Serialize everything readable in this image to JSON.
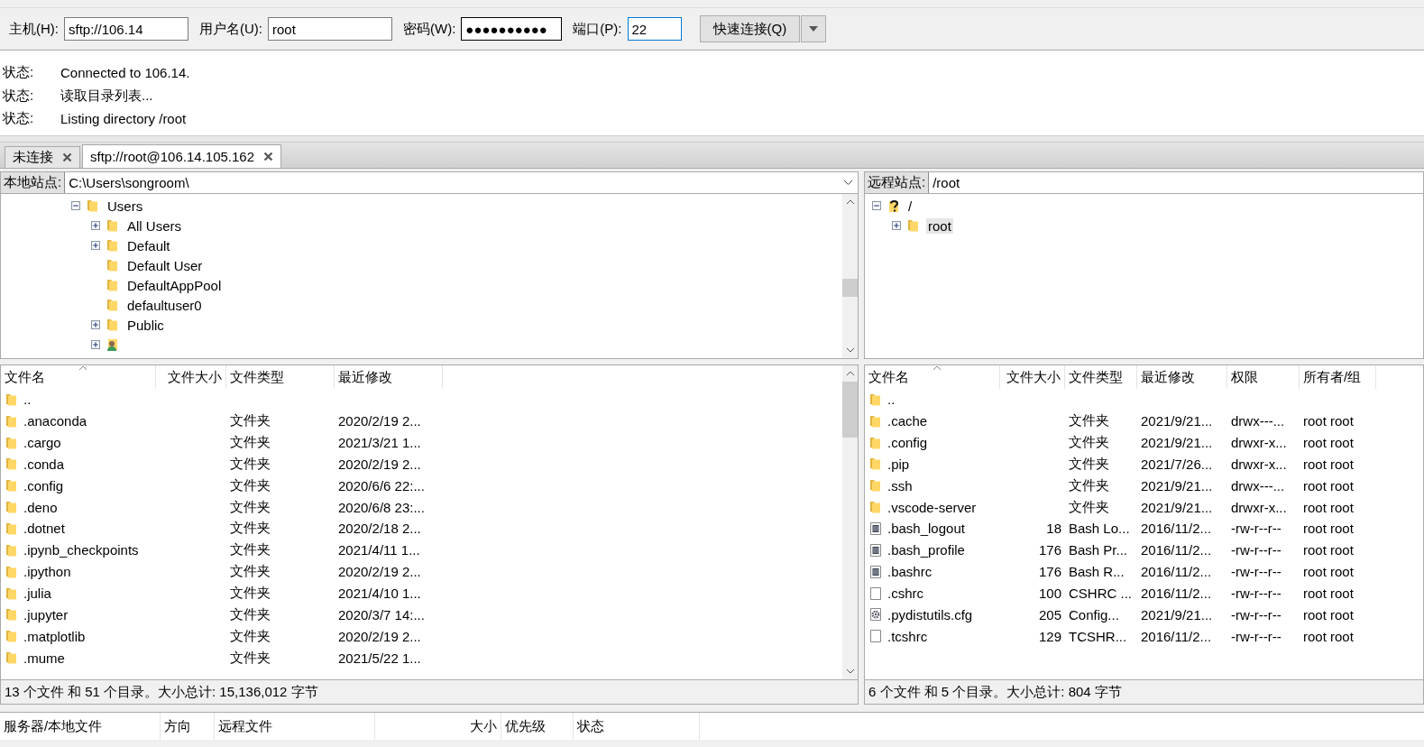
{
  "quickconnect": {
    "fields": [
      {
        "label": "主机(H):",
        "value": "sftp://106.14",
        "kind": "text"
      },
      {
        "label": "用户名(U):",
        "value": "root",
        "kind": "text"
      },
      {
        "label": "密码(W):",
        "value": "●●●●●●●●●●",
        "kind": "password"
      },
      {
        "label": "端口(P):",
        "value": "22",
        "kind": "port"
      }
    ],
    "button": "快速连接(Q)"
  },
  "log": [
    {
      "label": "状态:",
      "message": "Connected to 106.14."
    },
    {
      "label": "状态:",
      "message": "读取目录列表..."
    },
    {
      "label": "状态:",
      "message": "Listing directory /root"
    }
  ],
  "tabs": [
    {
      "label": "未连接",
      "selected": false
    },
    {
      "label": "sftp://root@106.14.105.162",
      "selected": true
    }
  ],
  "local": {
    "site_label": "本地站点:",
    "path": "C:\\Users\\songroom\\",
    "tree": [
      {
        "name": "Users",
        "kind": "folder",
        "expanded": true,
        "children": [
          {
            "name": "All Users",
            "kind": "folder",
            "expanded": false
          },
          {
            "name": "Default",
            "kind": "folder",
            "expanded": false
          },
          {
            "name": "Default User",
            "kind": "folder"
          },
          {
            "name": "DefaultAppPool",
            "kind": "folder"
          },
          {
            "name": "defaultuser0",
            "kind": "folder"
          },
          {
            "name": "Public",
            "kind": "folder",
            "expanded": false
          },
          {
            "kind": "user",
            "expanded": false
          }
        ]
      }
    ],
    "columns": [
      "文件名",
      "文件大小",
      "文件类型",
      "最近修改"
    ],
    "rows": [
      {
        "kind": "folder",
        "cells": [
          "..",
          "",
          "",
          ""
        ]
      },
      {
        "kind": "folder",
        "cells": [
          ".anaconda",
          "",
          "文件夹",
          "2020/2/19 2..."
        ]
      },
      {
        "kind": "folder",
        "cells": [
          ".cargo",
          "",
          "文件夹",
          "2021/3/21 1..."
        ]
      },
      {
        "kind": "folder",
        "cells": [
          ".conda",
          "",
          "文件夹",
          "2020/2/19 2..."
        ]
      },
      {
        "kind": "folder",
        "cells": [
          ".config",
          "",
          "文件夹",
          "2020/6/6 22:..."
        ]
      },
      {
        "kind": "folder",
        "cells": [
          ".deno",
          "",
          "文件夹",
          "2020/6/8 23:..."
        ]
      },
      {
        "kind": "folder",
        "cells": [
          ".dotnet",
          "",
          "文件夹",
          "2020/2/18 2..."
        ]
      },
      {
        "kind": "folder",
        "cells": [
          ".ipynb_checkpoints",
          "",
          "文件夹",
          "2021/4/11 1..."
        ]
      },
      {
        "kind": "folder",
        "cells": [
          ".ipython",
          "",
          "文件夹",
          "2020/2/19 2..."
        ]
      },
      {
        "kind": "folder",
        "cells": [
          ".julia",
          "",
          "文件夹",
          "2021/4/10 1..."
        ]
      },
      {
        "kind": "folder",
        "cells": [
          ".jupyter",
          "",
          "文件夹",
          "2020/3/7 14:..."
        ]
      },
      {
        "kind": "folder",
        "cells": [
          ".matplotlib",
          "",
          "文件夹",
          "2020/2/19 2..."
        ]
      },
      {
        "kind": "folder",
        "cells": [
          ".mume",
          "",
          "文件夹",
          "2021/5/22 1..."
        ]
      }
    ],
    "status": "13 个文件 和 51 个目录。大小总计: 15,136,012 字节"
  },
  "remote": {
    "site_label": "远程站点:",
    "path": "/root",
    "tree": [
      {
        "name": "/",
        "kind": "unknown",
        "expanded": true,
        "selected": false,
        "children": [
          {
            "name": "root",
            "kind": "folder",
            "expanded": false,
            "selected": true
          }
        ]
      }
    ],
    "columns": [
      "文件名",
      "文件大小",
      "文件类型",
      "最近修改",
      "权限",
      "所有者/组"
    ],
    "rows": [
      {
        "kind": "folder",
        "cells": [
          "..",
          "",
          "",
          "",
          "",
          ""
        ]
      },
      {
        "kind": "folder",
        "cells": [
          ".cache",
          "",
          "文件夹",
          "2021/9/21...",
          "drwx---...",
          "root root"
        ]
      },
      {
        "kind": "folder",
        "cells": [
          ".config",
          "",
          "文件夹",
          "2021/9/21...",
          "drwxr-x...",
          "root root"
        ]
      },
      {
        "kind": "folder",
        "cells": [
          ".pip",
          "",
          "文件夹",
          "2021/7/26...",
          "drwxr-x...",
          "root root"
        ]
      },
      {
        "kind": "folder",
        "cells": [
          ".ssh",
          "",
          "文件夹",
          "2021/9/21...",
          "drwx---...",
          "root root"
        ]
      },
      {
        "kind": "folder",
        "cells": [
          ".vscode-server",
          "",
          "文件夹",
          "2021/9/21...",
          "drwxr-x...",
          "root root"
        ]
      },
      {
        "kind": "text",
        "cells": [
          ".bash_logout",
          "18",
          "Bash Lo...",
          "2016/11/2...",
          "-rw-r--r--",
          "root root"
        ]
      },
      {
        "kind": "text",
        "cells": [
          ".bash_profile",
          "176",
          "Bash Pr...",
          "2016/11/2...",
          "-rw-r--r--",
          "root root"
        ]
      },
      {
        "kind": "text",
        "cells": [
          ".bashrc",
          "176",
          "Bash R...",
          "2016/11/2...",
          "-rw-r--r--",
          "root root"
        ]
      },
      {
        "kind": "file",
        "cells": [
          ".cshrc",
          "100",
          "CSHRC ...",
          "2016/11/2...",
          "-rw-r--r--",
          "root root"
        ]
      },
      {
        "kind": "config",
        "cells": [
          ".pydistutils.cfg",
          "205",
          "Config...",
          "2021/9/21...",
          "-rw-r--r--",
          "root root"
        ]
      },
      {
        "kind": "file",
        "cells": [
          ".tcshrc",
          "129",
          "TCSHR...",
          "2016/11/2...",
          "-rw-r--r--",
          "root root"
        ]
      }
    ],
    "status": "6 个文件 和 5 个目录。大小总计: 804 字节"
  },
  "queue": {
    "columns": [
      "服务器/本地文件",
      "方向",
      "远程文件",
      "大小",
      "优先级",
      "状态"
    ]
  }
}
